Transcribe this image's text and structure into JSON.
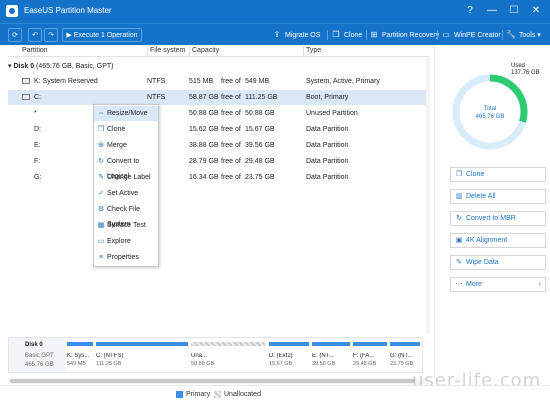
{
  "app": {
    "title": "EaseUS Partition Master"
  },
  "window_controls": {
    "help": "?",
    "minimize": "—",
    "maximize": "☐",
    "close": "✕"
  },
  "toolbar": {
    "refresh": "⟳",
    "undo": "↶",
    "redo": "↷",
    "execute_label": "Execute 1 Operation",
    "migrate_os": "Migrate OS",
    "clone": "Clone",
    "partition_recovery": "Partition Recovery",
    "winpe_creator": "WinPE Creator",
    "tools": "Tools"
  },
  "table": {
    "headers": [
      "Partition",
      "File system",
      "Capacity",
      "Type"
    ],
    "disk_label": "Disk 0",
    "disk_info": "(465.76 GB, Basic, GPT)",
    "rows": [
      {
        "partition": "K: System Reserved",
        "fs": "NTFS",
        "used": "515 MB",
        "free_of": "free of",
        "total": "549 MB",
        "type": "System, Active, Primary"
      },
      {
        "partition": "C:",
        "fs": "NTFS",
        "used": "58.87 GB",
        "free_of": "free of",
        "total": "111.25 GB",
        "type": "Boot, Primary"
      },
      {
        "partition": "*",
        "fs": "",
        "used": "50.88 GB",
        "free_of": "free of",
        "total": "50.88 GB",
        "type": "Unused Partition"
      },
      {
        "partition": "D:",
        "fs": "",
        "used": "15.62 GB",
        "free_of": "free of",
        "total": "15.67 GB",
        "type": "Data Partition"
      },
      {
        "partition": "E:",
        "fs": "",
        "used": "38.88 GB",
        "free_of": "free of",
        "total": "39.56 GB",
        "type": "Data Partition"
      },
      {
        "partition": "F:",
        "fs": "",
        "used": "28.79 GB",
        "free_of": "free of",
        "total": "29.48 GB",
        "type": "Data Partition"
      },
      {
        "partition": "G:",
        "fs": "",
        "used": "16.34 GB",
        "free_of": "free of",
        "total": "23.75 GB",
        "type": "Data Partition"
      }
    ]
  },
  "context_menu": [
    {
      "label": "Resize/Move",
      "icon": "resize-icon",
      "glyph": "⇔"
    },
    {
      "label": "Clone",
      "icon": "clone-icon",
      "glyph": "❐"
    },
    {
      "label": "Merge",
      "icon": "merge-icon",
      "glyph": "⊕"
    },
    {
      "label": "Convert to Logical",
      "icon": "convert-icon",
      "glyph": "↻"
    },
    {
      "label": "Change Label",
      "icon": "label-icon",
      "glyph": "✎"
    },
    {
      "label": "Set Active",
      "icon": "set-active-icon",
      "glyph": "✓"
    },
    {
      "label": "Check File System",
      "icon": "check-icon",
      "glyph": "⚙"
    },
    {
      "label": "Surface Test",
      "icon": "surface-icon",
      "glyph": "▦"
    },
    {
      "label": "Explore",
      "icon": "explore-icon",
      "glyph": "▭"
    },
    {
      "label": "Properties",
      "icon": "properties-icon",
      "glyph": "≡"
    }
  ],
  "sidebar": {
    "used_label": "Used",
    "used_value": "137.76 GB",
    "total_label": "Total",
    "total_value": "465.76 GB",
    "used_fraction": 0.296,
    "buttons": [
      "Clone",
      "Delete All",
      "Convert to MBR",
      "4K Alignment",
      "Wipe Data",
      "More"
    ]
  },
  "disk_map": {
    "disk": "Disk 0",
    "type": "Basic GPT",
    "size": "465.76 GB",
    "partitions": [
      {
        "l1": "K: Sys...",
        "l2": "549 MB"
      },
      {
        "l1": "C: (NTFS)",
        "l2": "111.25 GB"
      },
      {
        "l1": "Una...",
        "l2": "50.88 GB"
      },
      {
        "l1": "D: (Ext2)",
        "l2": "15.67 GB"
      },
      {
        "l1": "E: (NT...",
        "l2": "39.56 GB"
      },
      {
        "l1": "F: (FA...",
        "l2": "29.48 GB"
      },
      {
        "l1": "G: (NT...",
        "l2": "23.75 GB"
      }
    ]
  },
  "legend": {
    "primary": "Primary",
    "unallocated": "Unallocated"
  },
  "watermark": "user-life.com",
  "colors": {
    "accent": "#1473c9",
    "used": "#2ecc71",
    "primary": "#3b8ee6",
    "unallocated": "#c8c8c8",
    "selected": "#dbe8f7"
  }
}
